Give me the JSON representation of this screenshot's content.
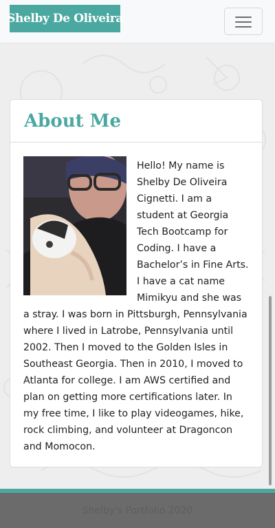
{
  "navbar": {
    "brand": "Shelby De Oliveira",
    "brand_color": "#4aa8a0",
    "toggle_icon": "hamburger-menu-icon"
  },
  "about": {
    "title": "About Me",
    "photo_alt": "Shelby De Oliveira holding a cat",
    "bio": "Hello! My name is Shelby De Oliveira Cignetti. I am a student at Georgia Tech Bootcamp for Coding. I have a Bachelor’s in Fine Arts. I have a cat name Mimikyu and she was a stray. I was born in Pittsburgh, Pennsylvania where I lived in Latrobe, Pennsylvania until 2002. Then I moved to the Golden Isles in Southeast Georgia. Then in 2010, I moved to Atlanta for college. I am AWS certified and plan on getting more certifications later. In my free time, I like to play videogames, hike, rock climbing, and volunteer at Dragoncon and Momocon."
  },
  "footer": {
    "text": "Shelby's Portfolio 2020",
    "accent_color": "#4aa8a0"
  }
}
